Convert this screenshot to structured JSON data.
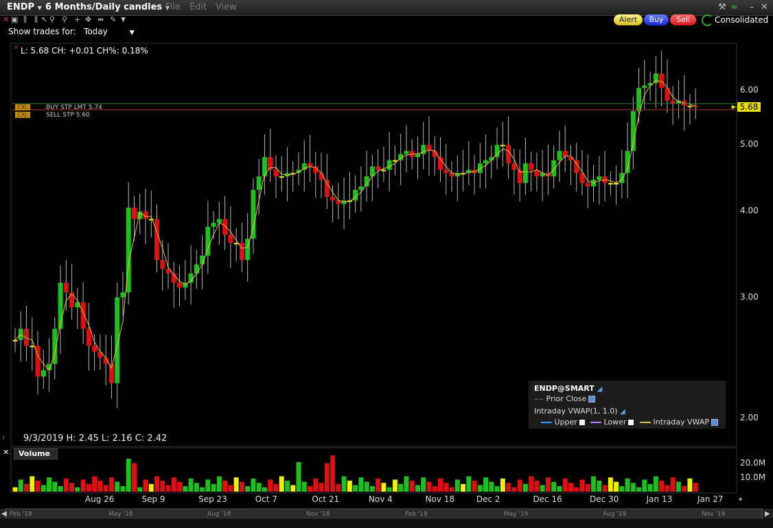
{
  "header": {
    "symbol": "ENDP",
    "timeframe": "6 Months/Daily candles",
    "menu": [
      "File",
      "Edit",
      "View"
    ],
    "alert": "Alert",
    "buy": "Buy",
    "sell": "Sell",
    "consolidated": "Consolidated"
  },
  "toolbar": {
    "show_trades_label": "Show trades for:",
    "show_trades_value": "Today"
  },
  "chart_header": "L: 5.68  CH: +0.01  CH%: 0.18%",
  "orders": [
    {
      "badge": "CXL",
      "label": "BUY STP LMT 5.74",
      "price": 5.74
    },
    {
      "badge": "CXL",
      "label": "SELL STP 5.60",
      "price": 5.6
    }
  ],
  "last_price": "5.68",
  "bar_info": "9/3/2019   H: 2.45  L: 2.16  C: 2.42",
  "legend": {
    "title": "ENDP@SMART",
    "prior_close": "Prior Close",
    "vwap_title": "Intraday VWAP(1, 1.0)",
    "upper": "Upper",
    "lower": "Lower",
    "vwap": "Intraday VWAP"
  },
  "volume_label": "Volume",
  "colors": {
    "up": "#1fbf1f",
    "down": "#e01010",
    "ma": "#f0c040",
    "neutral": "#f0f000"
  },
  "chart_data": [
    {
      "type": "candlestick",
      "title": "ENDP 6 Months/Daily candles",
      "scale": "log",
      "ylim": [
        1.9,
        7.0
      ],
      "yticks": [
        "6.00",
        "5.00",
        "4.00",
        "3.00",
        "2.00"
      ],
      "ytick_values": [
        6.0,
        5.0,
        4.0,
        3.0,
        2.0
      ],
      "xticks": [
        "Aug 26",
        "Sep 9",
        "Sep 23",
        "Oct 7",
        "Oct 21",
        "Nov 4",
        "Nov 18",
        "Dec 2",
        "Dec 16",
        "Dec 30",
        "Jan 13",
        "Jan 27"
      ],
      "xtick_index": [
        15,
        25,
        35,
        45,
        55,
        65,
        75,
        84,
        94,
        104,
        114,
        123
      ],
      "closes": [
        2.6,
        2.7,
        2.55,
        2.55,
        2.3,
        2.35,
        2.4,
        2.7,
        3.15,
        3.05,
        2.9,
        2.95,
        2.7,
        2.55,
        2.5,
        2.45,
        2.4,
        2.25,
        3.0,
        3.05,
        4.05,
        3.9,
        4.0,
        3.9,
        3.9,
        3.4,
        3.3,
        3.25,
        3.15,
        3.1,
        3.15,
        3.25,
        3.35,
        3.45,
        3.8,
        3.85,
        3.9,
        3.7,
        3.6,
        3.6,
        3.4,
        3.65,
        4.3,
        4.5,
        4.8,
        4.6,
        4.5,
        4.5,
        4.55,
        4.55,
        4.6,
        4.7,
        4.65,
        4.55,
        4.45,
        4.2,
        4.15,
        4.1,
        4.15,
        4.15,
        4.3,
        4.35,
        4.5,
        4.65,
        4.6,
        4.6,
        4.75,
        4.75,
        4.85,
        4.9,
        4.8,
        4.85,
        5.0,
        4.9,
        4.8,
        4.6,
        4.55,
        4.5,
        4.55,
        4.55,
        4.6,
        4.55,
        4.7,
        4.75,
        4.8,
        5.0,
        5.0,
        4.7,
        4.6,
        4.4,
        4.7,
        4.6,
        4.5,
        4.55,
        4.5,
        4.75,
        4.9,
        4.8,
        4.75,
        4.55,
        4.4,
        4.35,
        4.45,
        4.5,
        4.4,
        4.4,
        4.4,
        4.55,
        4.9,
        5.6,
        6.05,
        6.1,
        6.15,
        6.35,
        6.05,
        5.8,
        5.75,
        5.8,
        5.7,
        5.7,
        5.68
      ],
      "volume_ticks": [
        "20.0M",
        "10.0M"
      ]
    }
  ],
  "year_ticks": [
    "Feb '18",
    "May '18",
    "Aug '18",
    "Nov '18",
    "Feb '19",
    "May '19",
    "Aug '19",
    "Nov '19"
  ]
}
